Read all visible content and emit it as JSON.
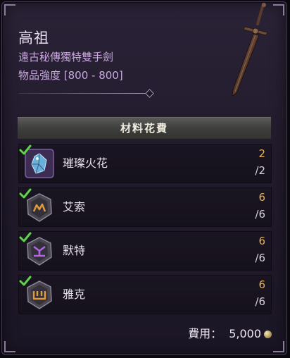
{
  "item": {
    "name": "高祖",
    "type": "遠古秘傳獨特雙手劍",
    "power": "物品強度 [800 - 800]"
  },
  "materials": {
    "header": "材料花費",
    "rows": [
      {
        "name": "璀璨火花",
        "have": "2",
        "need": "/2",
        "icon": "crystal-spark-icon"
      },
      {
        "name": "艾索",
        "have": "6",
        "need": "/6",
        "icon": "rune-icon"
      },
      {
        "name": "默特",
        "have": "6",
        "need": "/6",
        "icon": "rune-icon"
      },
      {
        "name": "雅克",
        "have": "6",
        "need": "/6",
        "icon": "rune-icon"
      }
    ]
  },
  "cost": {
    "label": "費用：",
    "value": "5,000",
    "icon": "gold-coin-icon"
  },
  "colors": {
    "owned_count": "#e7b25a",
    "item_name": "#e8dcef",
    "item_type": "#c9a8e0",
    "check": "#5fd34a"
  }
}
